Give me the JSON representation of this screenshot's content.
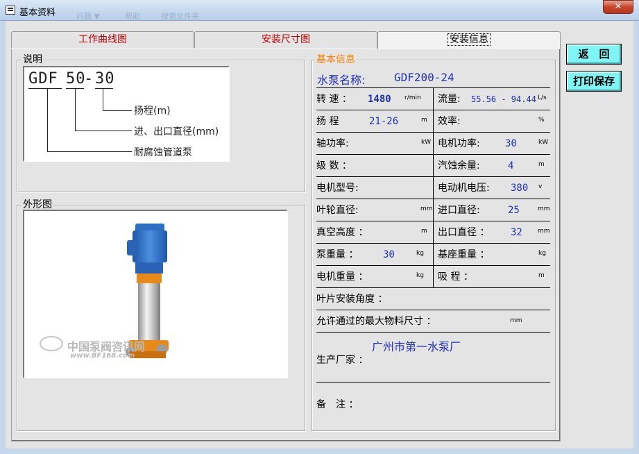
{
  "window": {
    "title": "基本资料",
    "close_glyph": "✕",
    "ghost_menu": [
      "问题 ▼",
      "帮助",
      "搜索文件夹"
    ]
  },
  "tabs": [
    {
      "label": "工作曲线图",
      "active": false
    },
    {
      "label": "安装尺寸图",
      "active": false
    },
    {
      "label": "安装信息",
      "active": true
    }
  ],
  "buttons": {
    "back": "返　回",
    "print_save": "打印保存"
  },
  "explanation": {
    "legend": "说明",
    "code_parts": [
      "GDF",
      "50",
      "-",
      "30"
    ],
    "callouts": [
      "扬程(m)",
      "进、出口直径(mm)",
      "耐腐蚀管道泵"
    ]
  },
  "appearance": {
    "legend": "外形图",
    "watermark_cn": "中国泵阀咨讯网",
    "watermark_url": "www.BF168.com"
  },
  "info": {
    "legend": "基本信息",
    "pump_name_label": "水泵名称:",
    "pump_name": "GDF200-24",
    "rows": [
      {
        "left": {
          "label": "转 速 ：",
          "value": "1480",
          "unit": "r/min",
          "bold": true
        },
        "right": {
          "label": "流量:",
          "value": "55.56 - 94.44",
          "unit": "L/s"
        }
      },
      {
        "left": {
          "label": "扬 程",
          "value": "21-26",
          "unit": "m"
        },
        "right": {
          "label": "效率:",
          "value": "",
          "unit": "%"
        }
      },
      {
        "left": {
          "label": "轴功率:",
          "value": "",
          "unit": "kW"
        },
        "right": {
          "label": "电机功率:",
          "value": "30",
          "unit": "kW"
        }
      },
      {
        "left": {
          "label": "级 数 ：",
          "value": "",
          "unit": ""
        },
        "right": {
          "label": "汽蚀余量:",
          "value": "4",
          "unit": "m"
        }
      },
      {
        "left": {
          "label": "电机型号:",
          "value": "",
          "unit": ""
        },
        "right": {
          "label": "电动机电压:",
          "value": "380",
          "unit": "v"
        }
      },
      {
        "left": {
          "label": "叶轮直径:",
          "value": "",
          "unit": "mm"
        },
        "right": {
          "label": "进口直径:",
          "value": "25",
          "unit": "mm"
        }
      },
      {
        "left": {
          "label": "真空高度 ：",
          "value": "",
          "unit": "m"
        },
        "right": {
          "label": "出口直径 ：",
          "value": "32",
          "unit": "mm"
        }
      },
      {
        "left": {
          "label": "泵重量 ：",
          "value": "30",
          "unit": "kg"
        },
        "right": {
          "label": "基座重量 ：",
          "value": "",
          "unit": "kg"
        }
      },
      {
        "left": {
          "label": "电机重量 ：",
          "value": "",
          "unit": "kg"
        },
        "right": {
          "label": "吸 程 ：",
          "value": "",
          "unit": "m"
        }
      }
    ],
    "blade_angle_label": "叶片安装角度 ：",
    "max_material_label": "允许通过的最大物料尺寸 ：",
    "max_material_unit": "mm",
    "manufacturer_label": "生产厂家 ：",
    "manufacturer": "广州市第一水泵厂",
    "remarks_label": "备　注 ："
  },
  "colors": {
    "tab_text": "#c00000",
    "legend_orange": "#ff8000",
    "value_blue": "#1f2fb8",
    "button_cyan": "#7ff5f5"
  }
}
